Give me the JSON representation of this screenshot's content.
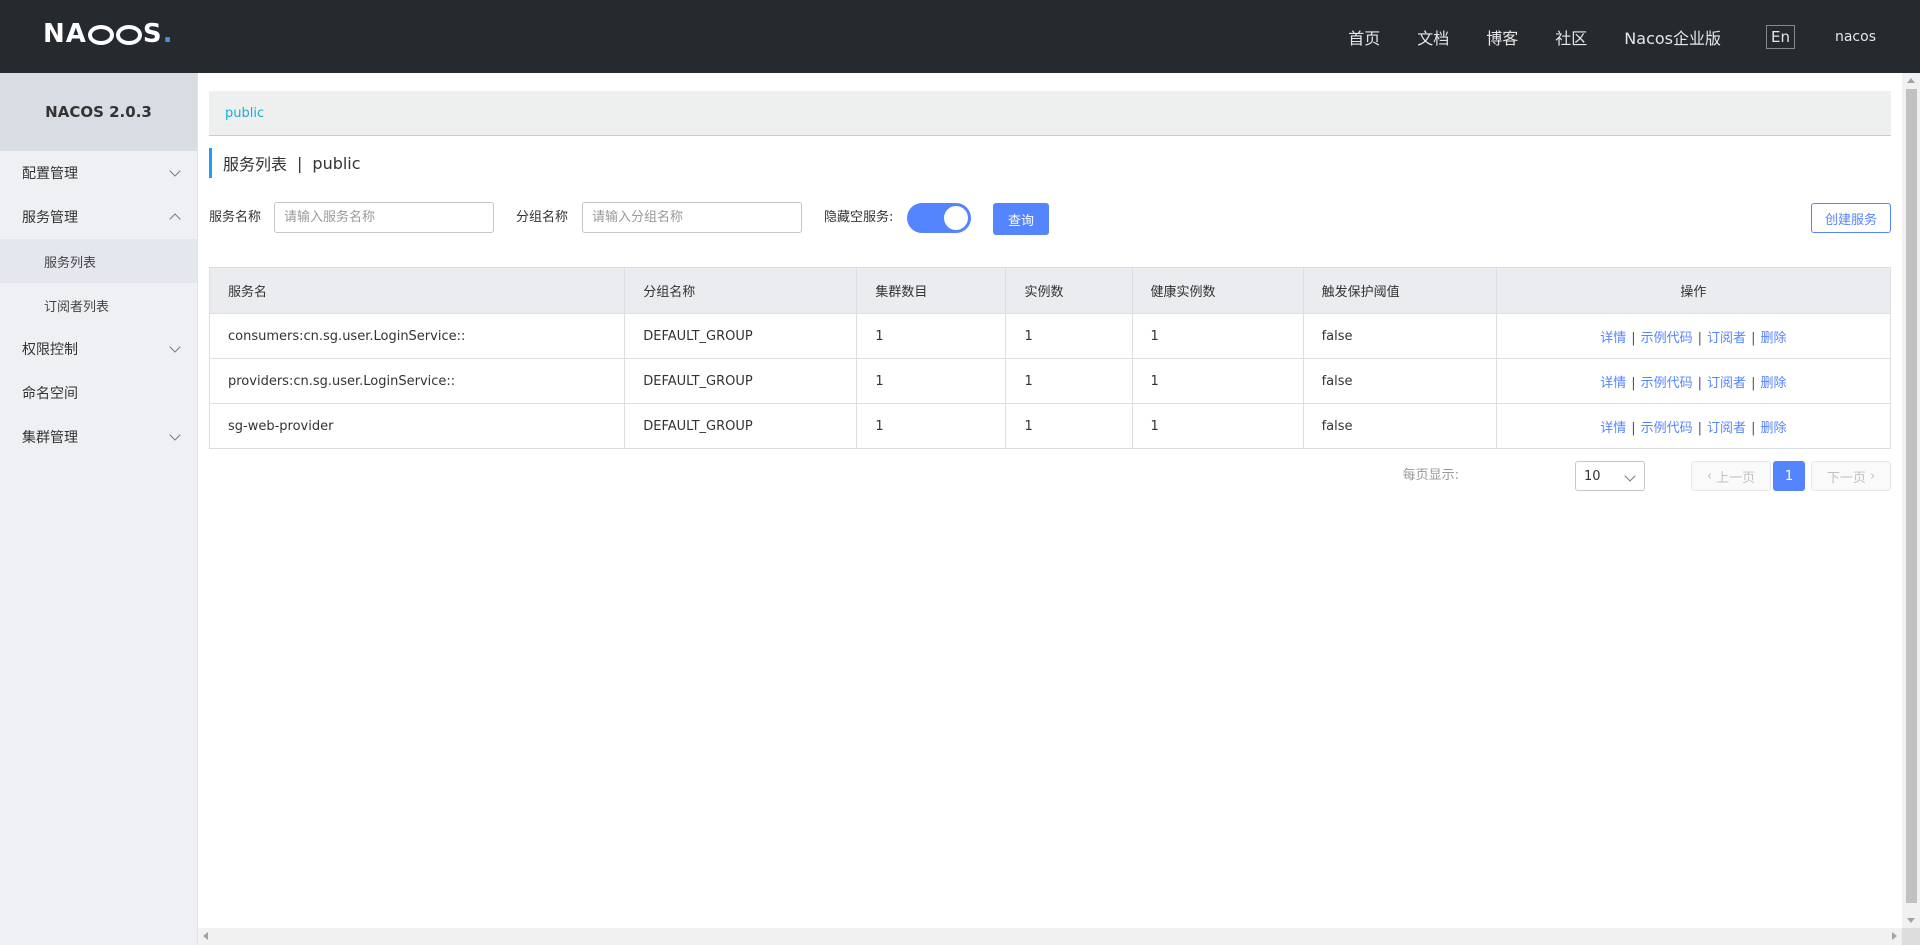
{
  "header": {
    "logo_text_pre": "NA",
    "logo_text_post": "S",
    "nav": [
      "首页",
      "文档",
      "博客",
      "社区",
      "Nacos企业版"
    ],
    "lang": "En",
    "user": "nacos"
  },
  "sidebar": {
    "version": "NACOS 2.0.3",
    "items": [
      {
        "label": "配置管理",
        "expanded": false
      },
      {
        "label": "服务管理",
        "expanded": true
      },
      {
        "label": "服务列表",
        "sub": true,
        "active": true
      },
      {
        "label": "订阅者列表",
        "sub": true
      },
      {
        "label": "权限控制",
        "expanded": false
      },
      {
        "label": "命名空间"
      },
      {
        "label": "集群管理",
        "expanded": false
      }
    ]
  },
  "namespace": {
    "current": "public"
  },
  "page": {
    "title": "服务列表",
    "separator": "|",
    "namespace": "public"
  },
  "filters": {
    "service_name_label": "服务名称",
    "service_name_placeholder": "请输入服务名称",
    "service_name_value": "",
    "group_name_label": "分组名称",
    "group_name_placeholder": "请输入分组名称",
    "group_name_value": "",
    "hide_empty_label": "隐藏空服务:",
    "hide_empty_on": true,
    "query_label": "查询",
    "create_label": "创建服务"
  },
  "table": {
    "headers": [
      "服务名",
      "分组名称",
      "集群数目",
      "实例数",
      "健康实例数",
      "触发保护阈值",
      "操作"
    ],
    "rows": [
      [
        "consumers:cn.sg.user.LoginService::",
        "DEFAULT_GROUP",
        "1",
        "1",
        "1",
        "false"
      ],
      [
        "providers:cn.sg.user.LoginService::",
        "DEFAULT_GROUP",
        "1",
        "1",
        "1",
        "false"
      ],
      [
        "sg-web-provider",
        "DEFAULT_GROUP",
        "1",
        "1",
        "1",
        "false"
      ]
    ],
    "actions": [
      "详情",
      "示例代码",
      "订阅者",
      "删除"
    ],
    "action_sep": "|"
  },
  "pagination": {
    "per_page_label": "每页显示:",
    "per_page_value": "10",
    "prev_label": "上一页",
    "next_label": "下一页",
    "current_page": "1"
  },
  "colors": {
    "header_bg": "#252a2f",
    "accent": "#5584ff",
    "link": "#1cacd4",
    "sidebar_bg": "#eef0f3"
  }
}
